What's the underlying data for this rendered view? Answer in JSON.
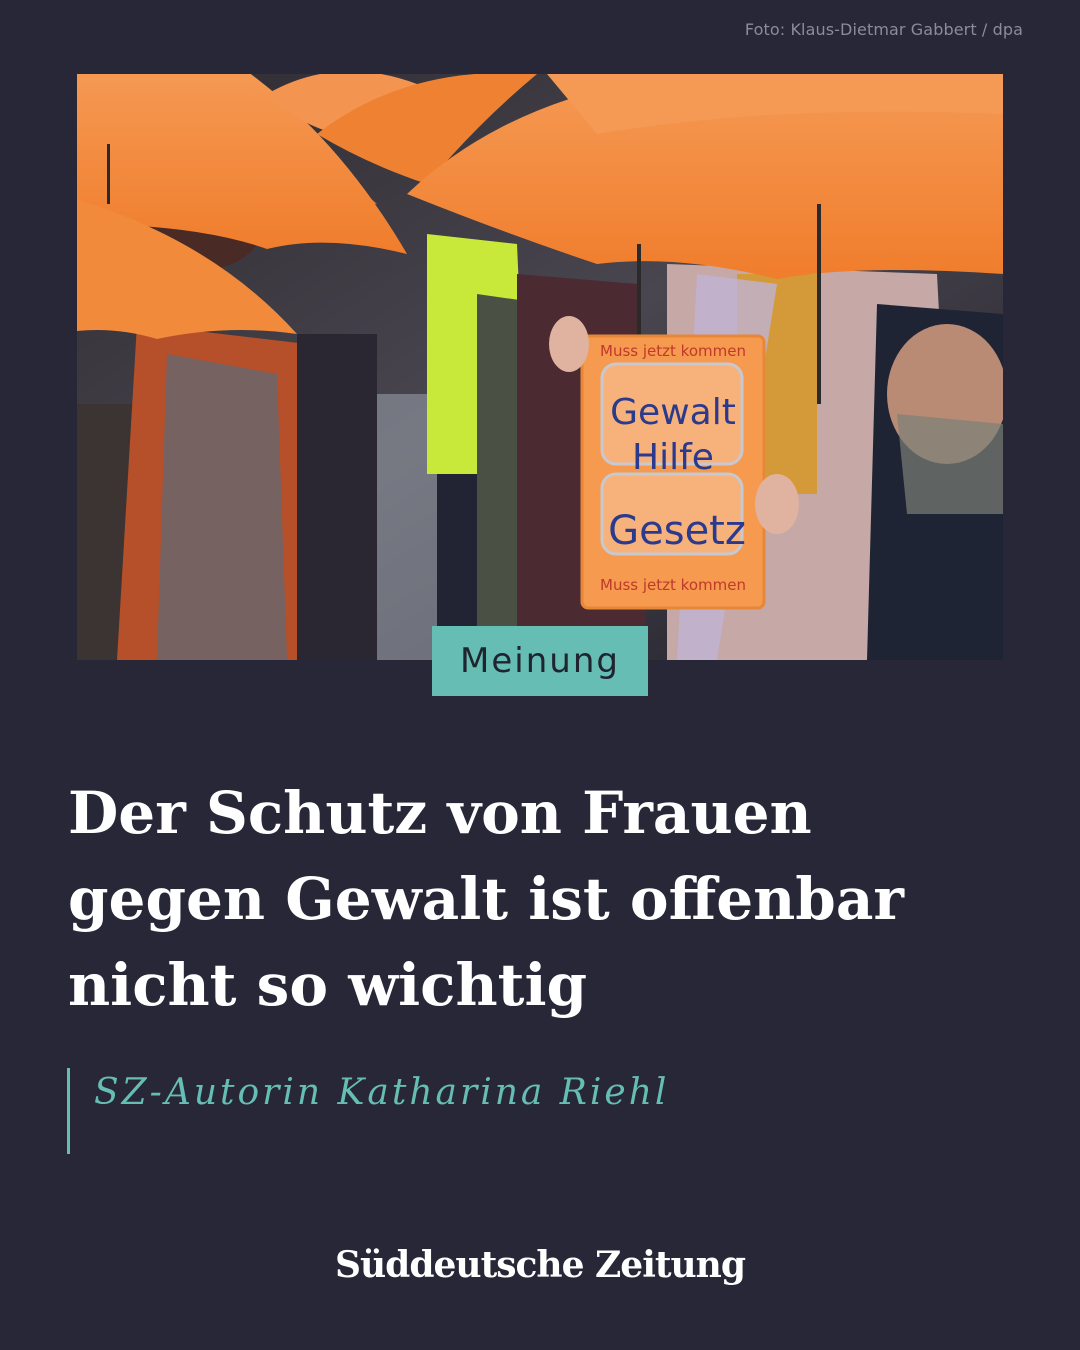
{
  "photo_credit": "Foto: Klaus-Dietmar Gabbert / dpa",
  "photo": {
    "sign_lines": [
      "Muss jetzt kommen",
      "Gewalt",
      "Hilfe",
      "Gesetz",
      "Muss jetzt kommen"
    ]
  },
  "category": "Meinung",
  "headline": "Der Schutz von Frauen gegen Gewalt ist offenbar nicht so wichtig",
  "author": "SZ-Autorin Katharina Riehl",
  "brand": "Süddeutsche Zeitung",
  "colors": {
    "background": "#272738",
    "accent": "#66bdb3",
    "umbrella": "#f28a3c"
  }
}
